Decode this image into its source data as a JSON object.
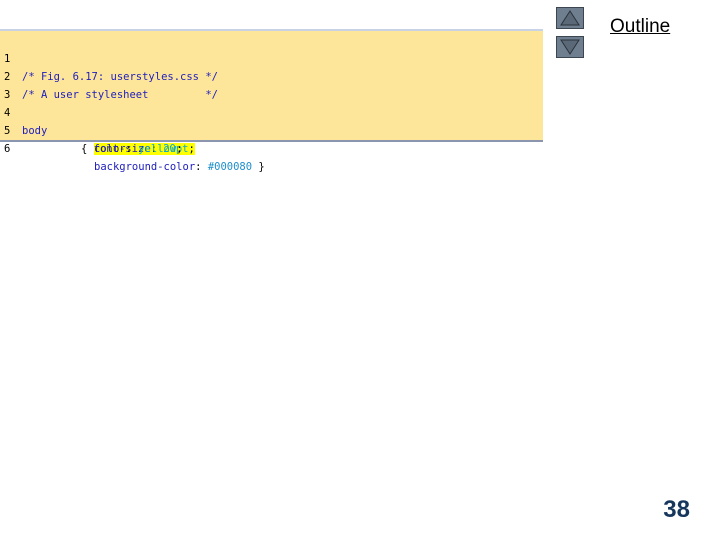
{
  "code": {
    "lines": [
      {
        "num": "1",
        "comment": "/* Fig. 6.17: userstyles.css */"
      },
      {
        "num": "2",
        "comment": "/* A user stylesheet         */"
      },
      {
        "num": "3"
      },
      {
        "num": "4",
        "selector": "body",
        "brace_open": "{ ",
        "prop": "font-size",
        "colon": ": ",
        "value": "20pt",
        "semi": ";"
      },
      {
        "num": "5",
        "prop": "color",
        "colon": ": ",
        "value": "yellow",
        "semi": ";"
      },
      {
        "num": "6",
        "prop": "background-color",
        "colon": ": ",
        "value": "#000080",
        "brace_close": " }"
      }
    ]
  },
  "nav": {
    "up_icon": "triangle-up-icon",
    "down_icon": "triangle-down-icon"
  },
  "outline_label": "Outline",
  "page_number": "38",
  "colors": {
    "code_background": "#fde59a",
    "highlight": "#ffff00",
    "nav_button": "#6f7f8f",
    "page_number": "#16365c"
  }
}
